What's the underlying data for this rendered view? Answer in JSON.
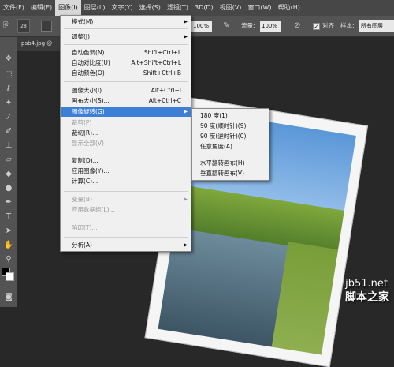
{
  "menubar": {
    "items": [
      "文件(F)",
      "编辑(E)",
      "图像(I)",
      "图层(L)",
      "文字(Y)",
      "选择(S)",
      "滤镜(T)",
      "3D(D)",
      "视图(V)",
      "窗口(W)",
      "帮助(H)"
    ]
  },
  "optbar": {
    "brush_size": "28",
    "zoom_value": "100%",
    "flow_label": "流量:",
    "flow_value": "100%",
    "align_label": "对齐",
    "sample_label": "样本:",
    "sample_value": "所有图层"
  },
  "doc_tab": {
    "label": "psb4.jpg @"
  },
  "image_menu": {
    "items": [
      {
        "label": "模式(M)",
        "shortcut": "",
        "submenu": true,
        "disabled": false
      },
      {
        "label": "调整(J)",
        "shortcut": "",
        "submenu": true,
        "disabled": false
      },
      {
        "label": "自动色调(N)",
        "shortcut": "Shift+Ctrl+L",
        "submenu": false,
        "disabled": false
      },
      {
        "label": "自动对比度(U)",
        "shortcut": "Alt+Shift+Ctrl+L",
        "submenu": false,
        "disabled": false
      },
      {
        "label": "自动颜色(O)",
        "shortcut": "Shift+Ctrl+B",
        "submenu": false,
        "disabled": false
      },
      {
        "label": "图像大小(I)...",
        "shortcut": "Alt+Ctrl+I",
        "submenu": false,
        "disabled": false
      },
      {
        "label": "画布大小(S)...",
        "shortcut": "Alt+Ctrl+C",
        "submenu": false,
        "disabled": false
      },
      {
        "label": "图像旋转(G)",
        "shortcut": "",
        "submenu": true,
        "disabled": false,
        "highlighted": true
      },
      {
        "label": "裁剪(P)",
        "shortcut": "",
        "submenu": false,
        "disabled": true
      },
      {
        "label": "裁切(R)...",
        "shortcut": "",
        "submenu": false,
        "disabled": false
      },
      {
        "label": "显示全部(V)",
        "shortcut": "",
        "submenu": false,
        "disabled": true
      },
      {
        "label": "复制(D)...",
        "shortcut": "",
        "submenu": false,
        "disabled": false
      },
      {
        "label": "应用图像(Y)...",
        "shortcut": "",
        "submenu": false,
        "disabled": false
      },
      {
        "label": "计算(C)...",
        "shortcut": "",
        "submenu": false,
        "disabled": false
      },
      {
        "label": "变量(B)",
        "shortcut": "",
        "submenu": true,
        "disabled": true
      },
      {
        "label": "应用数据组(L)...",
        "shortcut": "",
        "submenu": false,
        "disabled": true
      },
      {
        "label": "陷印(T)...",
        "shortcut": "",
        "submenu": false,
        "disabled": true
      },
      {
        "label": "分析(A)",
        "shortcut": "",
        "submenu": true,
        "disabled": false
      }
    ]
  },
  "rotate_menu": {
    "items": [
      "180 度(1)",
      "90 度(顺时针)(9)",
      "90 度(逆时针)(0)",
      "任意角度(A)...",
      "水平翻转画布(H)",
      "垂直翻转画布(V)"
    ]
  },
  "watermark": {
    "site": "jb51.net",
    "name": "脚本之家"
  },
  "colors": {
    "menu_highlight": "#3d7fd6",
    "menubar_bg": "#474747",
    "panel_bg": "#535353",
    "canvas_bg": "#282828"
  }
}
